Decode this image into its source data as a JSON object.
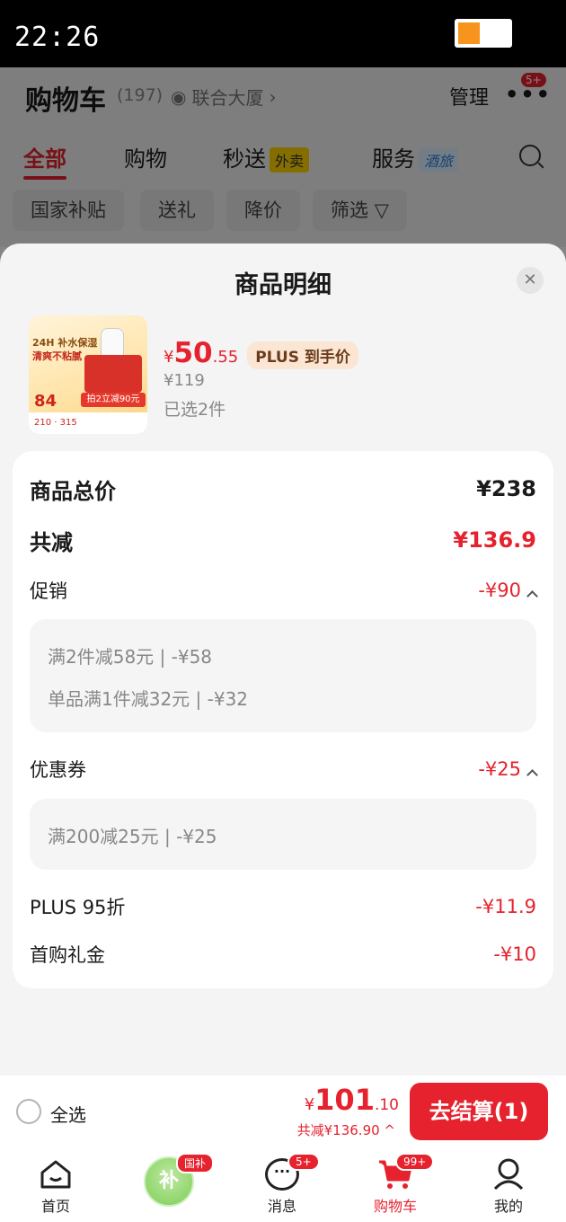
{
  "status_bar": {
    "time": "22:26"
  },
  "cart_header": {
    "title": "购物车",
    "count": "(197)",
    "address": "联合大厦",
    "manage": "管理",
    "more_badge": "5+"
  },
  "top_tabs": [
    {
      "label": "全部"
    },
    {
      "label": "购物"
    },
    {
      "label": "秒送",
      "tag": "外卖"
    },
    {
      "label": "服务",
      "tag": "酒旅"
    }
  ],
  "filter_chips": [
    "国家补贴",
    "送礼",
    "降价",
    "筛选"
  ],
  "sheet": {
    "title": "商品明细",
    "product": {
      "image_text_1": "24H 补水保湿",
      "image_text_2": "清爽不粘腻",
      "image_price": "84",
      "image_bar": "拍2立减90元",
      "image_foot": "210 · 315",
      "price_yen": "¥",
      "price_int": "50",
      "price_dec": ".55",
      "plus_tag": "PLUS 到手价",
      "original_price": "¥119",
      "selected": "已选2件"
    },
    "breakdown": {
      "total_label": "商品总价",
      "total_value": "¥238",
      "discount_label": "共减",
      "discount_value": "¥136.9",
      "promo_label": "促销",
      "promo_value": "-¥90",
      "promo_items": [
        "满2件减58元 | -¥58",
        "单品满1件减32元 | -¥32"
      ],
      "coupon_label": "优惠券",
      "coupon_value": "-¥25",
      "coupon_items": [
        "满200减25元 | -¥25"
      ],
      "plus_label": "PLUS 95折",
      "plus_value": "-¥11.9",
      "gift_label": "首购礼金",
      "gift_value": "-¥10"
    }
  },
  "bottom_bar": {
    "select_all": "全选",
    "total_yen": "¥",
    "total_int": "101",
    "total_dec": ".10",
    "saved": "共减¥136.90 ^",
    "checkout": "去结算(1)"
  },
  "tab_bar": [
    {
      "label": "首页"
    },
    {
      "label": "补",
      "badge": "国补"
    },
    {
      "label": "消息",
      "badge": "5+"
    },
    {
      "label": "购物车",
      "badge": "99+"
    },
    {
      "label": "我的"
    }
  ],
  "colors": {
    "accent": "#e5222d",
    "plus_tag_bg": "#fbe6d3",
    "sheet_bg": "#f4f4f4"
  }
}
